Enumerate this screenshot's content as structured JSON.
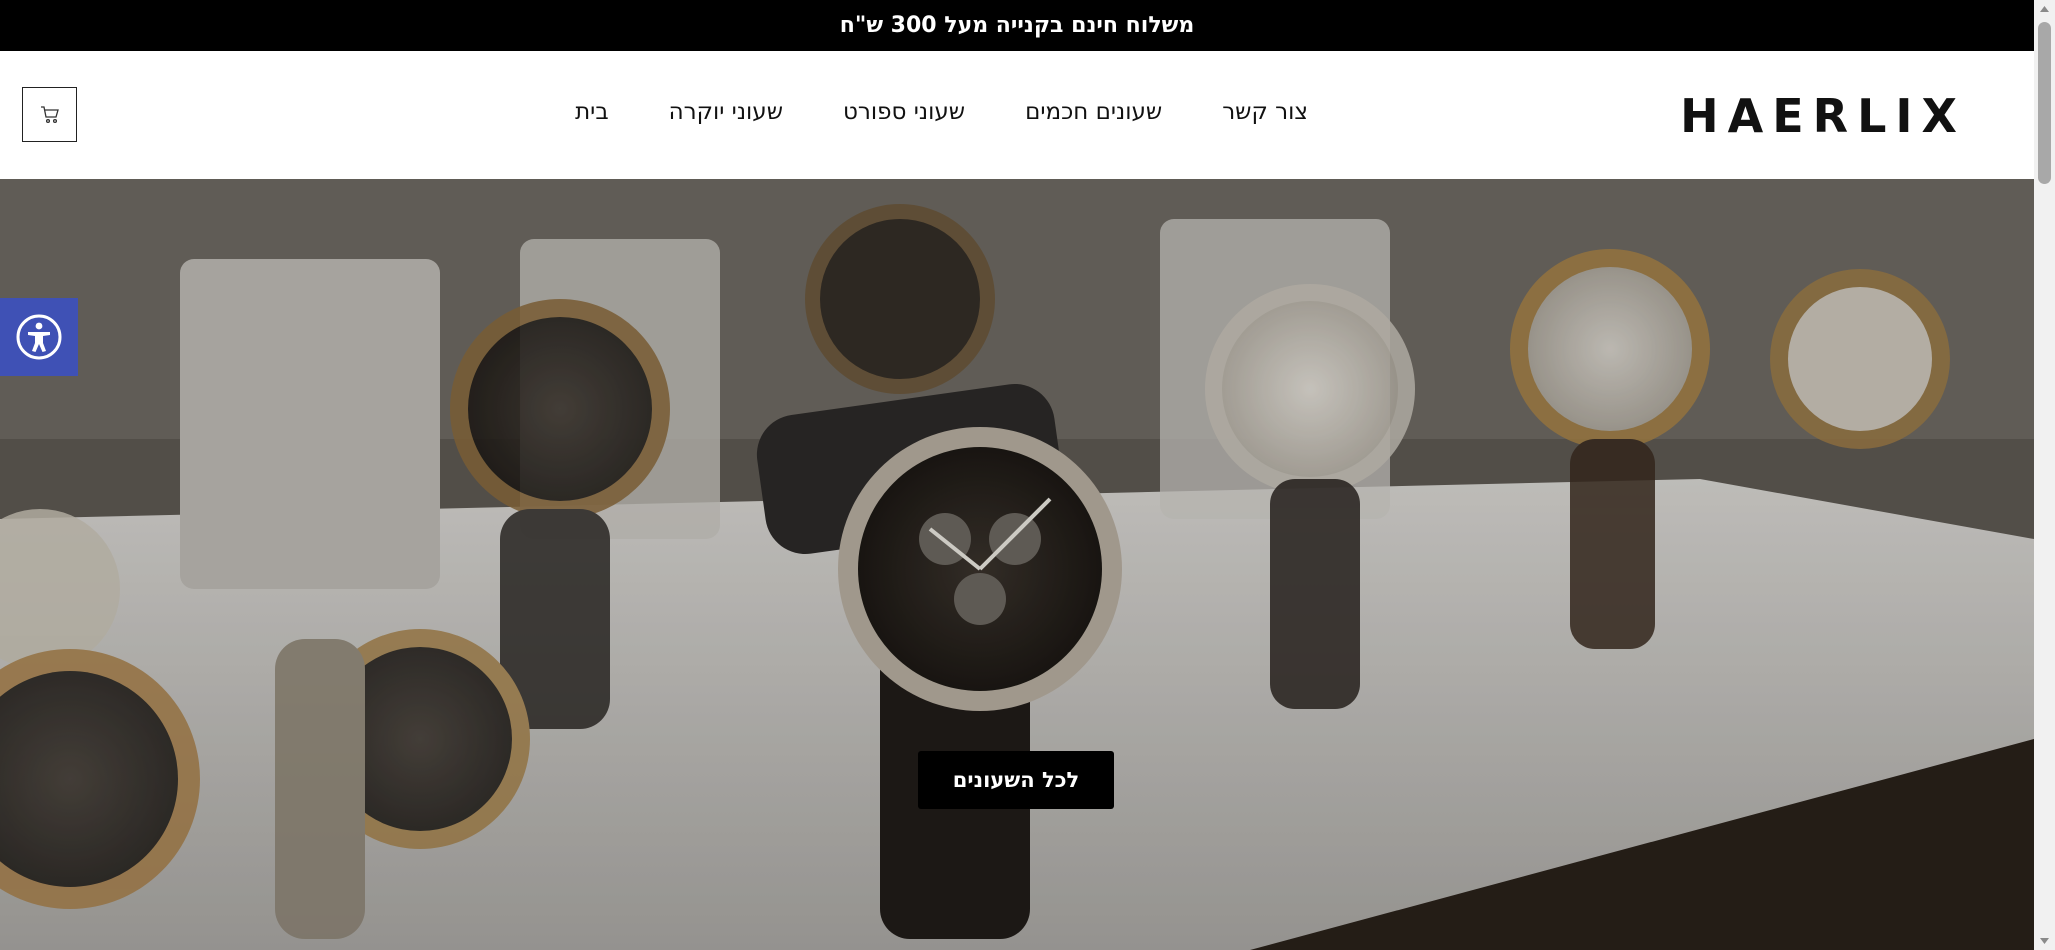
{
  "announcement": {
    "text": "משלוח חינם בקנייה מעל 300 ש\"ח"
  },
  "header": {
    "logo": "HAERLIX",
    "nav": [
      "בית",
      "שעוני יוקרה",
      "שעוני ספורט",
      "שעונים חכמים",
      "צור קשר"
    ],
    "cart_icon": "cart-icon"
  },
  "hero": {
    "button_label": "לכל השעונים",
    "image": "luxury watches display photo"
  },
  "accessibility": {
    "icon": "accessibility-icon"
  },
  "colors": {
    "announcement_bg": "#000000",
    "accessibility_bg": "#3f51b5",
    "button_bg": "#000000"
  }
}
